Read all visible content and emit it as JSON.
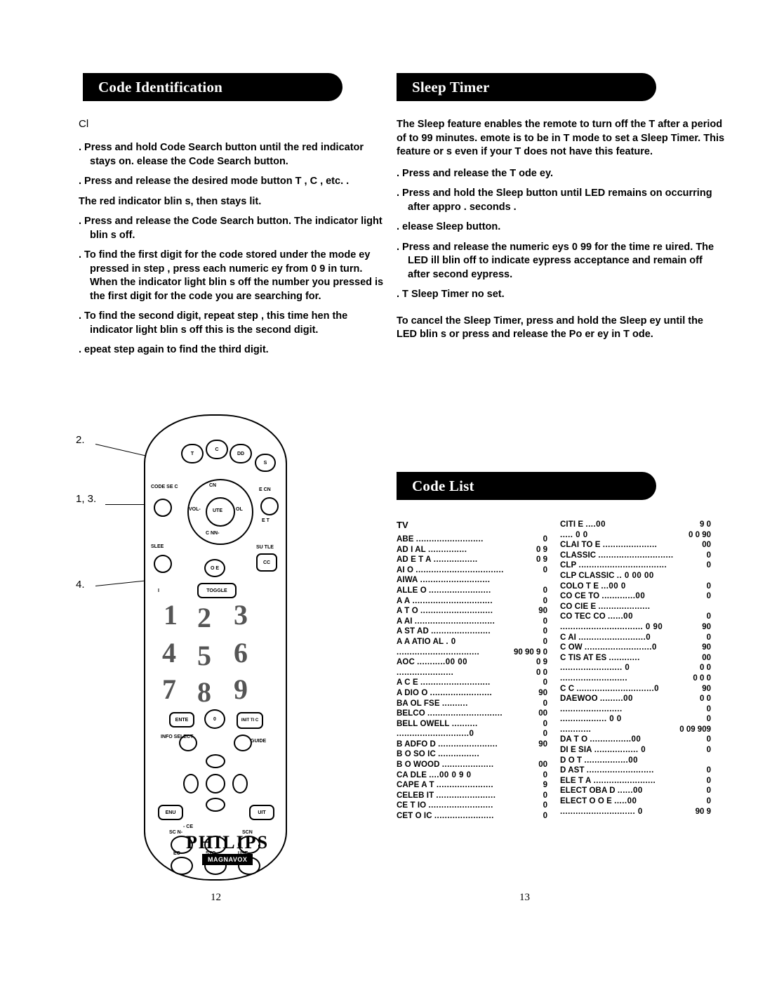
{
  "headers": {
    "code_identification": "Code Identification",
    "sleep_timer": "Sleep Timer",
    "code_list": "Code List"
  },
  "left": {
    "intro": "Cl",
    "steps": [
      ".  Press and hold Code Search button until the red indicator stays on.  elease the Code Search button.",
      ".  Press and release the desired mode button  T ,  C , etc. .",
      ".  Press and release the Code Search button. The indicator light blin s off.",
      ".  To find the first digit for the code stored under the mode  ey pressed in step  , press each numeric  ey from 0  9 in turn. When the indicator light blin s off the number you pressed is the first digit for the code you are searching for.",
      ".  To find the second digit, repeat step  , this time  hen the indicator light blin s off this is the second digit.",
      ".  epeat step   again to find the third digit."
    ],
    "note_after_step2": "The red indicator blin s, then stays lit."
  },
  "right": {
    "sleep_intro": "The Sleep feature enables the remote to turn off the T  after a period of   to 99 minutes.  emote is to be in T  mode to set a Sleep Timer. This feature  or s even if your T  does not have this feature.",
    "sleep_steps": [
      ".  Press and release the T   ode  ey.",
      ".  Press and hold the Sleep button until LED remains on  occurring after appro .   seconds .",
      ".  elease Sleep button.",
      ".  Press and release the numeric  eys 0  99 for the time re uired. The LED  ill blin  off to indicate  eypress acceptance and remain off after second  eypress.",
      ".  T  Sleep Timer no  set."
    ],
    "cancel": "To cancel the Sleep Timer, press and hold the Sleep  ey until the LED blin s or press and release the Po er  ey in T   ode."
  },
  "callouts": {
    "two": "2.",
    "one_three": "1, 3.",
    "four": "4."
  },
  "page_numbers": {
    "left": "12",
    "right": "13"
  },
  "remote": {
    "top_buttons": [
      "T",
      "C",
      "DD",
      "S "
    ],
    "left_buttons": [
      "CODE SE C",
      "SLEE ",
      " O E"
    ],
    "right_buttons": [
      "E  CN",
      " E T",
      "SU TLE",
      "CC"
    ],
    "dpad": [
      "CN ",
      "VOL-",
      " OL",
      "UTE",
      "C NN-"
    ],
    "toggle": "TOGGLE",
    "toggle_prefix": "I",
    "numbers": [
      "1",
      "2",
      "3",
      "4",
      "5",
      "6",
      "7",
      "8",
      "9"
    ],
    "lower_buttons": [
      "ENTE",
      " INIT TI C",
      "0",
      "INFO  SELECT",
      "GUIDE",
      " ENU",
      " UIT",
      "SC N-",
      "SCN ",
      " EC",
      "STO",
      " USE",
      "-  CE"
    ],
    "brand": "PHILIPS",
    "sub_brand": "MAGNAVOX"
  },
  "code_list": {
    "left_title": "TV",
    "left_entries": [
      {
        "name": "ABE",
        "dots": "..........................",
        "nums": "0"
      },
      {
        "name": "AD  I  AL",
        "dots": "...............",
        "nums": "0  9"
      },
      {
        "name": "AD  E  T   A",
        "dots": ".................",
        "nums": " 0  9"
      },
      {
        "name": "AI  O",
        "dots": "..................................",
        "nums": "0"
      },
      {
        "name": "AIWA",
        "dots": "...........................",
        "nums": ""
      },
      {
        "name": "ALLE  O",
        "dots": "........................",
        "nums": "0"
      },
      {
        "name": "A   A",
        "dots": "...............................",
        "nums": "0"
      },
      {
        "name": "A   T  O",
        "dots": "............................",
        "nums": "90"
      },
      {
        "name": "A   AI",
        "dots": "...............................",
        "nums": "0"
      },
      {
        "name": "A   ST  AD",
        "dots": ".......................",
        "nums": "0"
      },
      {
        "name": "A   A     ATIO  AL",
        "dots": ". 0",
        "nums": "0"
      },
      {
        "name": "",
        "dots": "................................",
        "nums": "90   90   9 0"
      },
      {
        "name": "AOC",
        "dots": "...........00    00",
        "nums": "0     9"
      },
      {
        "name": "",
        "dots": "......................",
        "nums": "0   0"
      },
      {
        "name": "A   C  E",
        "dots": "...........................",
        "nums": "0"
      },
      {
        "name": "A  DIO  O",
        "dots": "........................",
        "nums": "90"
      },
      {
        "name": "BA      OL  FSE",
        "dots": "..........",
        "nums": "0"
      },
      {
        "name": "BELCO",
        "dots": ".............................",
        "nums": "00"
      },
      {
        "name": "BELL      OWELL",
        "dots": "..........",
        "nums": "0"
      },
      {
        "name": "",
        "dots": "............................0",
        "nums": "0"
      },
      {
        "name": "B   ADFO  D",
        "dots": ".......................",
        "nums": "90"
      },
      {
        "name": "B  O  SO  IC",
        "dots": "................",
        "nums": ""
      },
      {
        "name": "B  O  WOOD",
        "dots": "....................",
        "nums": "00"
      },
      {
        "name": "CA   DLE",
        "dots": "....00   0  9   0",
        "nums": "0"
      },
      {
        "name": "CAPE   A  T",
        "dots": "......................",
        "nums": "9"
      },
      {
        "name": "CELEB   IT",
        "dots": ".......................",
        "nums": "0"
      },
      {
        "name": "CE  T   IO",
        "dots": ".........................",
        "nums": "0"
      },
      {
        "name": "CET  O  IC",
        "dots": ".......................",
        "nums": "0"
      }
    ],
    "right_entries": [
      {
        "name": "CITI  E",
        "dots": "  ....00",
        "nums": "9  0"
      },
      {
        "name": "",
        "dots": ".....  0   0",
        "nums": "0    0  90"
      },
      {
        "name": "CLAI  TO   E",
        "dots": ".....................",
        "nums": "00"
      },
      {
        "name": "CLASSIC",
        "dots": ".............................",
        "nums": "0"
      },
      {
        "name": "CLP",
        "dots": "..................................",
        "nums": "0"
      },
      {
        "name": "CLP  CLASSIC",
        "dots": "..  0     00   00",
        "nums": ""
      },
      {
        "name": "COLO   T    E",
        "dots": "...00   0",
        "nums": "0"
      },
      {
        "name": "CO   CE   TO",
        "dots": ".............00",
        "nums": "0"
      },
      {
        "name": "CO   CIE     E",
        "dots": "....................",
        "nums": ""
      },
      {
        "name": "CO   TEC  CO",
        "dots": "......00",
        "nums": "0"
      },
      {
        "name": "",
        "dots": "................................ 0   90",
        "nums": "90"
      },
      {
        "name": "C   AI",
        "dots": "..........................0",
        "nums": "0"
      },
      {
        "name": "C   OW",
        "dots": "..........................0",
        "nums": "90"
      },
      {
        "name": "C   TIS    AT  ES",
        "dots": "............",
        "nums": "00"
      },
      {
        "name": "",
        "dots": "........................ 0",
        "nums": "0    0"
      },
      {
        "name": "",
        "dots": "..........................",
        "nums": "0    0     0"
      },
      {
        "name": "C   C",
        "dots": "..............................0",
        "nums": "90"
      },
      {
        "name": "DAEWOO",
        "dots": ".........00",
        "nums": "0     0"
      },
      {
        "name": "",
        "dots": "........................",
        "nums": "0"
      },
      {
        "name": "",
        "dots": "..................  0   0",
        "nums": "0"
      },
      {
        "name": "",
        "dots": "............",
        "nums": "0    09   909"
      },
      {
        "name": "DA  T  O",
        "dots": "................00",
        "nums": "0"
      },
      {
        "name": "DI   E   SIA",
        "dots": "................. 0",
        "nums": "0"
      },
      {
        "name": "D     O  T",
        "dots": ".................00",
        "nums": ""
      },
      {
        "name": "D     AST",
        "dots": "..........................",
        "nums": "0"
      },
      {
        "name": "ELE   T    A",
        "dots": "........................",
        "nums": "0"
      },
      {
        "name": "ELECT   OBA   D",
        "dots": "......00",
        "nums": "0"
      },
      {
        "name": "ELECT  O  O  E",
        "dots": ".....00",
        "nums": "0"
      },
      {
        "name": "",
        "dots": "............................. 0",
        "nums": "90   9"
      }
    ]
  }
}
